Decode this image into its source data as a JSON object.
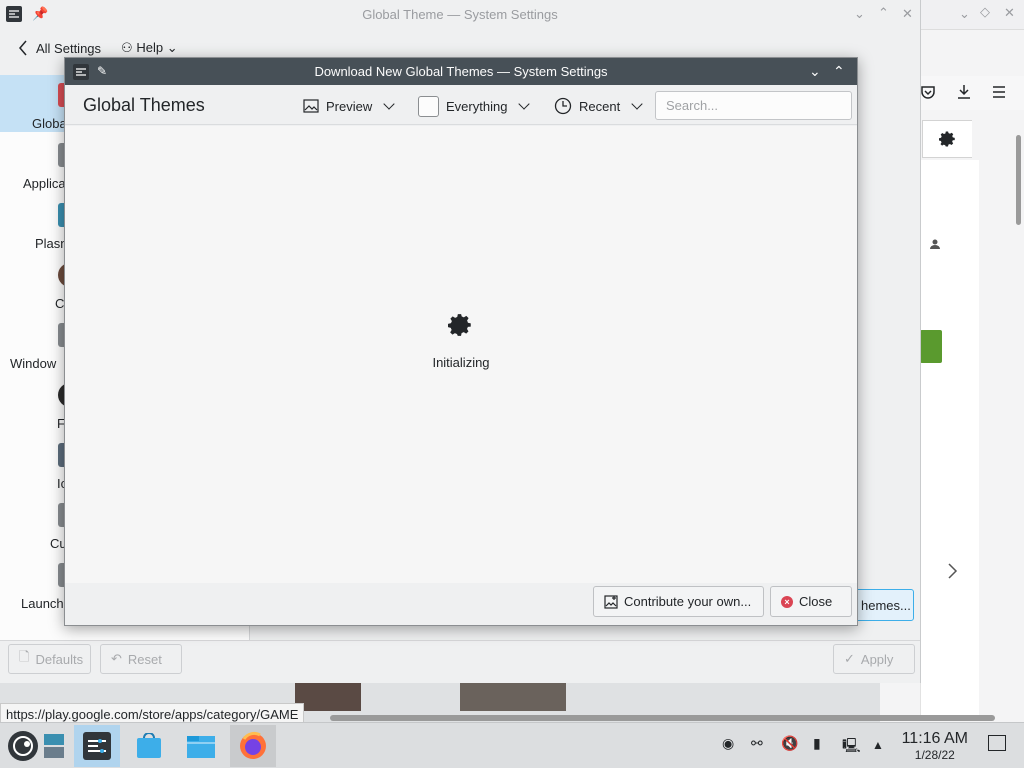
{
  "background_window": {
    "title": "Global Theme — System Settings",
    "nav_back_label": "All Settings",
    "help_label": "Help",
    "sidebar_items": [
      {
        "label": "Globa",
        "color": "#d64c53"
      },
      {
        "label": "Applica",
        "color": "#888c90"
      },
      {
        "label": "Plasn",
        "color": "#3a8fb0"
      },
      {
        "label": "Co",
        "color": "#6b4a3c"
      },
      {
        "label": "Window",
        "color": "#888c90"
      },
      {
        "label": "Fo",
        "color": "#2b2b2b"
      },
      {
        "label": "Ic",
        "color": "#5c6d7c"
      },
      {
        "label": "Cu",
        "color": "#888c90"
      },
      {
        "label": "Launch",
        "color": "#888c90"
      }
    ],
    "defaults_label": "Defaults",
    "reset_label": "Reset",
    "apply_label": "Apply",
    "get_themes_label": "hemes..."
  },
  "dialog": {
    "title": "Download New Global Themes — System Settings",
    "header_title": "Global Themes",
    "preview_label": "Preview",
    "filter_label": "Everything",
    "sort_label": "Recent",
    "search_placeholder": "Search...",
    "status_text": "Initializing",
    "contribute_label": "Contribute your own...",
    "close_label": "Close"
  },
  "status_url": "https://play.google.com/store/apps/category/GAME",
  "taskbar": {
    "time": "11:16 AM",
    "date": "1/28/22"
  },
  "colors": {
    "accent": "#3daee9",
    "dialog_titlebar": "#475057",
    "close_red": "#da4453"
  }
}
